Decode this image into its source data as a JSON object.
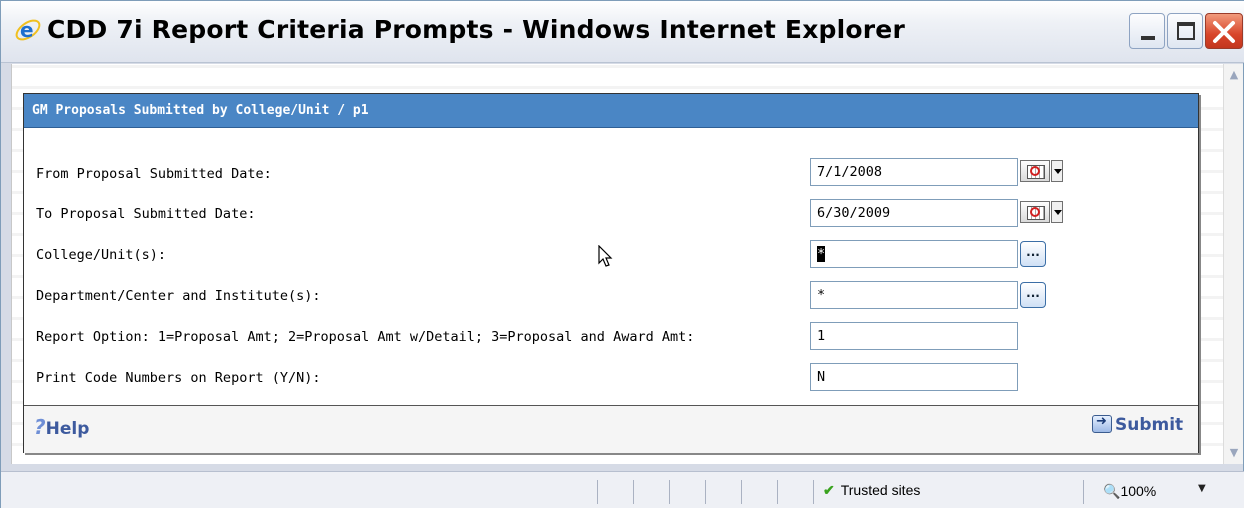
{
  "window": {
    "title": "CDD 7i Report Criteria Prompts - Windows Internet Explorer"
  },
  "panel": {
    "title": "GM Proposals Submitted by College/Unit /  p1",
    "rows": [
      {
        "label": "From Proposal Submitted Date:",
        "value": "7/1/2008"
      },
      {
        "label": "To Proposal Submitted Date:",
        "value": "6/30/2009"
      },
      {
        "label": "College/Unit(s):",
        "value": "*"
      },
      {
        "label": "Department/Center and Institute(s):",
        "value": "*"
      },
      {
        "label": "Report Option: 1=Proposal Amt; 2=Proposal Amt w/Detail; 3=Proposal and Award Amt:",
        "value": "1"
      },
      {
        "label": "Print Code Numbers on Report (Y/N):",
        "value": "N"
      }
    ],
    "browse_label": "...",
    "help_label": "Help",
    "submit_label": "Submit"
  },
  "status": {
    "zone": "Trusted sites",
    "zoom": "100%"
  },
  "icons": {
    "browser": "ie-logo-icon",
    "calendar": "calendar-icon",
    "help": "help-icon",
    "submit": "submit-icon",
    "check": "checkmark-icon",
    "zoom": "zoom-icon"
  },
  "colors": {
    "panel_header": "#4a86c5",
    "link": "#3d5a9e",
    "close_button": "#d8452a"
  }
}
